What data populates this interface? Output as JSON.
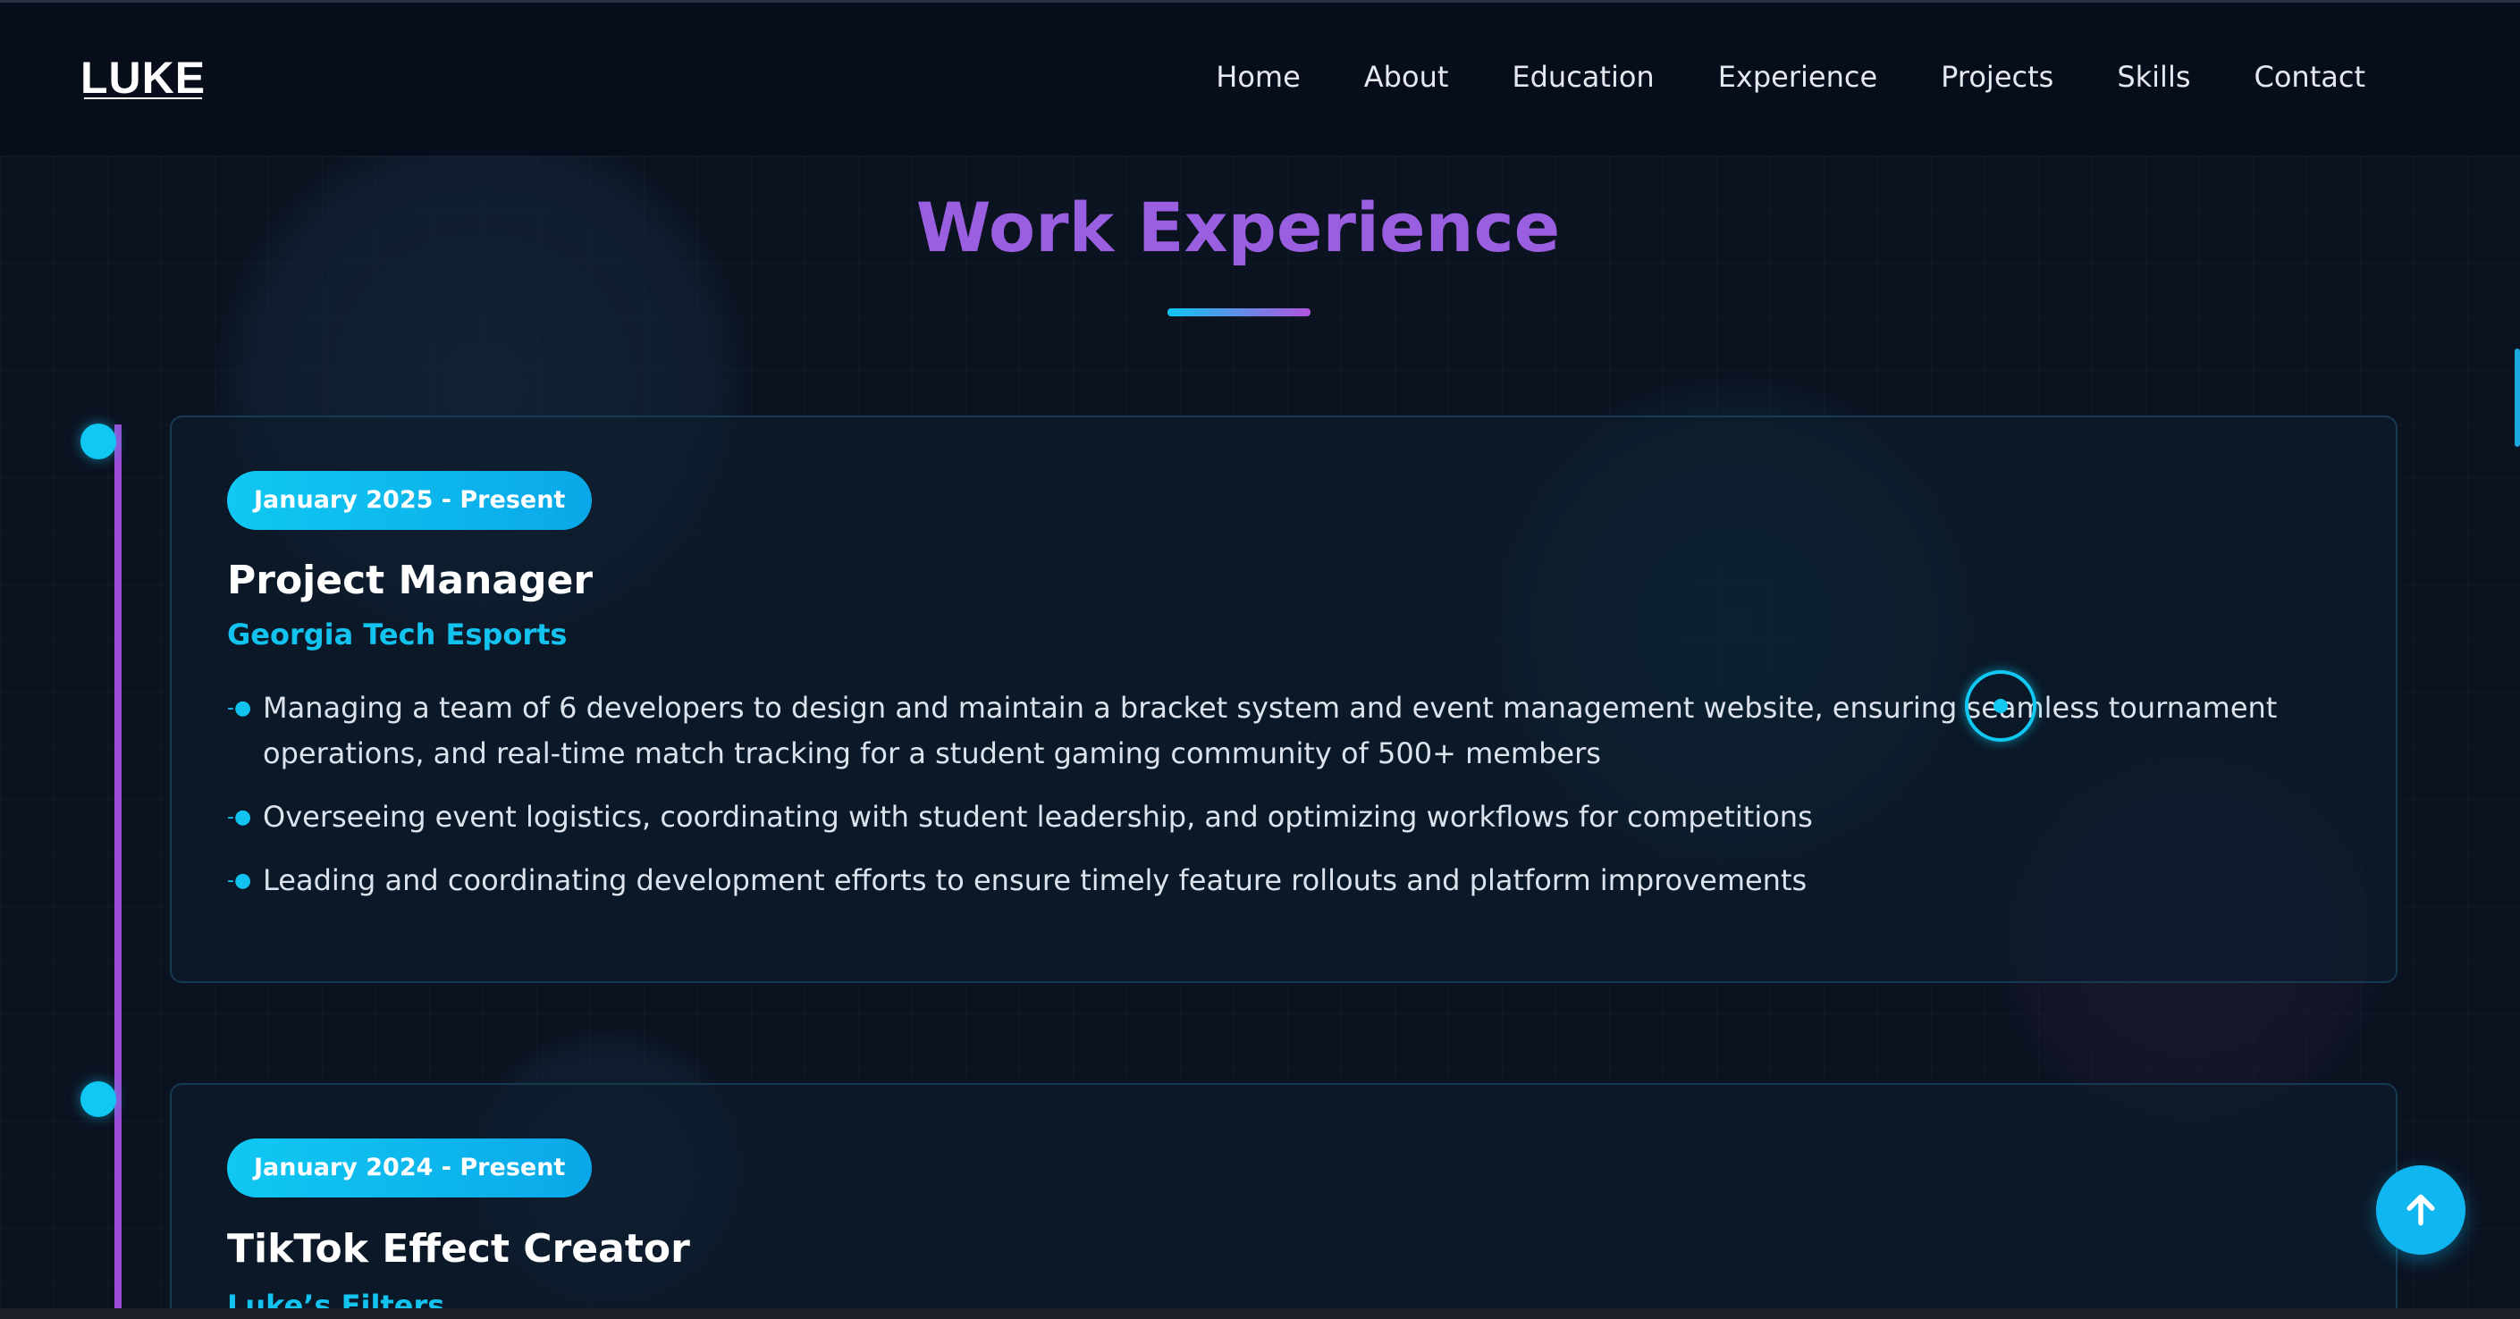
{
  "brand": {
    "logo": "LUKE"
  },
  "nav": {
    "items": [
      {
        "label": "Home"
      },
      {
        "label": "About"
      },
      {
        "label": "Education"
      },
      {
        "label": "Experience"
      },
      {
        "label": "Projects"
      },
      {
        "label": "Skills"
      },
      {
        "label": "Contact"
      }
    ]
  },
  "section": {
    "title": "Work Experience"
  },
  "experience": [
    {
      "date": "January 2025 - Present",
      "role": "Project Manager",
      "company": "Georgia Tech Esports",
      "bullets": [
        "Managing a team of 6 developers to design and maintain a bracket system and event management website, ensuring seamless tournament operations, and real-time match tracking for a student gaming community of 500+ members",
        "Overseeing event logistics, coordinating with student leadership, and optimizing workflows for competitions",
        "Leading and coordinating development efforts to ensure timely feature rollouts and platform improvements"
      ]
    },
    {
      "date": "January 2024 - Present",
      "role": "TikTok Effect Creator",
      "company": "Luke’s Filters"
    }
  ],
  "colors": {
    "accent": "#10c8f2",
    "purple": "#9a5fe0",
    "background": "#0b1220"
  },
  "icons": {
    "scroll_top": "arrow-up-icon",
    "bullet": "arrow-right-icon"
  }
}
